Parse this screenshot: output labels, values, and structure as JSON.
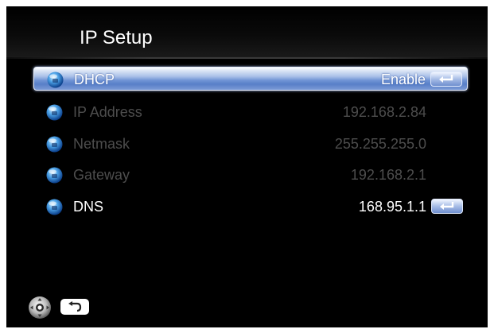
{
  "header": {
    "title": "IP Setup"
  },
  "settings": {
    "rows": [
      {
        "label": "DHCP",
        "value": "Enable",
        "selected": true,
        "editable": true
      },
      {
        "label": "IP Address",
        "value": "192.168.2.84",
        "selected": false,
        "editable": false
      },
      {
        "label": "Netmask",
        "value": "255.255.255.0",
        "selected": false,
        "editable": false
      },
      {
        "label": "Gateway",
        "value": "192.168.2.1",
        "selected": false,
        "editable": false
      },
      {
        "label": "DNS",
        "value": "168.95.1.1",
        "selected": false,
        "editable": true
      }
    ]
  },
  "footer": {
    "icons": [
      "dpad-icon",
      "back-icon"
    ]
  },
  "colors": {
    "background": "#000000",
    "selection": "#6f93d4",
    "dim_text": "#4d4d4d",
    "active_text": "#ffffff"
  }
}
